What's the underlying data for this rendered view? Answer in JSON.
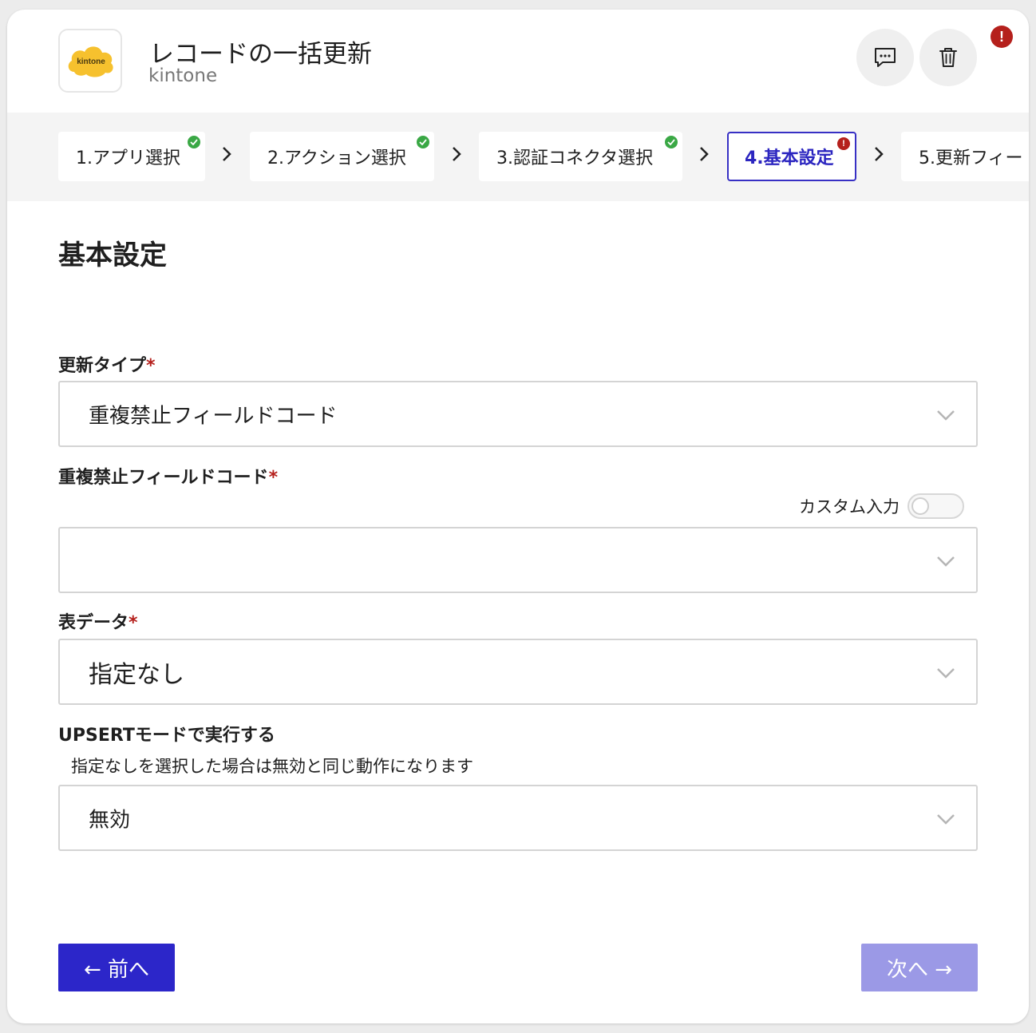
{
  "header": {
    "logo_text": "kintone",
    "title": "レコードの一括更新",
    "subtitle": "kintone",
    "comment_icon": "comment-dots-icon",
    "delete_icon": "trash-icon",
    "alert_text": "!"
  },
  "steps": [
    {
      "label": "1.アプリ選択",
      "status": "complete"
    },
    {
      "label": "2.アクション選択",
      "status": "complete"
    },
    {
      "label": "3.認証コネクタ選択",
      "status": "complete"
    },
    {
      "label": "4.基本設定",
      "status": "error",
      "error_mark": "!"
    },
    {
      "label": "5.更新フィー",
      "status": "pending"
    }
  ],
  "colors": {
    "accent": "#2c26c9",
    "error": "#b5201c",
    "success": "#3aa845",
    "disabled_button": "#9b99e6"
  },
  "section": {
    "title": "基本設定"
  },
  "form": {
    "required_mark": "*",
    "update_type": {
      "label": "更新タイプ",
      "value": "重複禁止フィールドコード"
    },
    "unique_field": {
      "label": "重複禁止フィールドコード",
      "value": "",
      "custom_input_label": "カスタム入力",
      "custom_input_on": false
    },
    "table_data": {
      "label": "表データ",
      "value": "指定なし"
    },
    "upsert": {
      "label": "UPSERTモードで実行する",
      "hint": "指定なしを選択した場合は無効と同じ動作になります",
      "value": "無効"
    }
  },
  "footer": {
    "prev_label": "← 前へ",
    "next_label": "次へ →",
    "next_enabled": false
  }
}
